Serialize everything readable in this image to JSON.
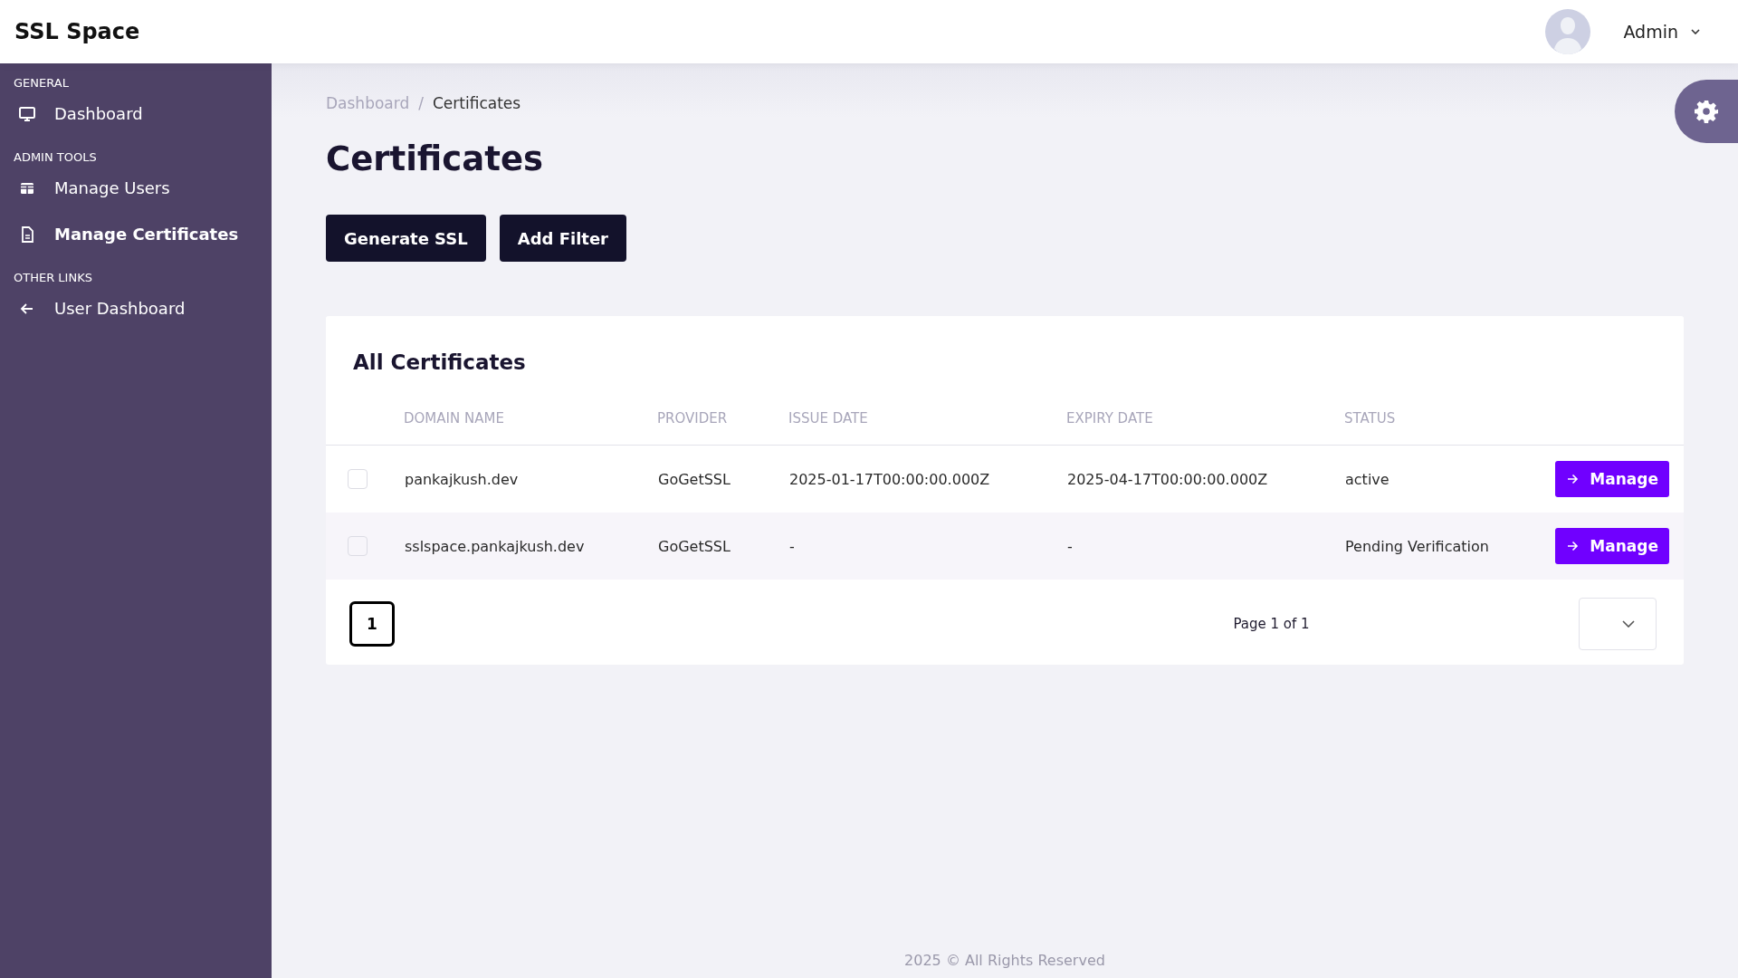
{
  "app_title": "SSL Space",
  "user_menu": {
    "name": "Admin"
  },
  "sidebar": {
    "sections": [
      {
        "heading": "GENERAL",
        "items": [
          {
            "label": "Dashboard",
            "selected": false
          }
        ]
      },
      {
        "heading": "ADMIN TOOLS",
        "items": [
          {
            "label": "Manage Users",
            "selected": false
          },
          {
            "label": "Manage Certificates",
            "selected": true
          }
        ]
      },
      {
        "heading": "OTHER LINKS",
        "items": [
          {
            "label": "User Dashboard",
            "selected": false
          }
        ]
      }
    ]
  },
  "breadcrumb": [
    "Dashboard",
    "/",
    "Certificates"
  ],
  "page_title": "Certificates",
  "actions": [
    "Generate SSL",
    "Add Filter"
  ],
  "card": {
    "title": "All Certificates",
    "table": {
      "columns": [
        "DOMAIN NAME",
        "PROVIDER",
        "ISSUE DATE",
        "EXPIRY DATE",
        "STATUS"
      ],
      "rows": [
        {
          "checked": false,
          "cells": [
            "pankajkush.dev",
            "GoGetSSL",
            "2025-01-17T00:00:00.000Z",
            "2025-04-17T00:00:00.000Z",
            "active"
          ],
          "action": "Manage"
        },
        {
          "checked": false,
          "cells": [
            "sslspace.pankajkush.dev",
            "GoGetSSL",
            "-",
            "-",
            "Pending Verification"
          ],
          "action": "Manage"
        }
      ]
    },
    "pagination": {
      "pages": [
        {
          "label": "1",
          "selected": true
        }
      ],
      "summary": "Page 1 of 1"
    }
  },
  "footer": "2025 © All Rights Reserved"
}
